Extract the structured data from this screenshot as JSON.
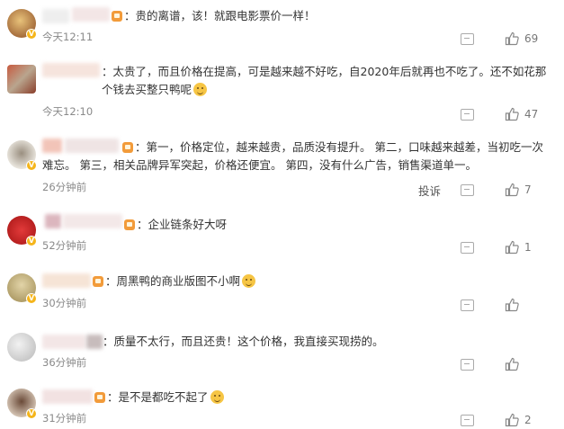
{
  "comments": [
    {
      "text": "：贵的离谱，该！就跟电影票价一样！",
      "time": "今天12:11",
      "likes": "69",
      "report": "",
      "avatar_color": "#c9863b",
      "name_colors": [
        "#e9e9e9",
        "#f2d9d9"
      ],
      "has_vip": true,
      "emoji": false
    },
    {
      "text": "：太贵了，而且价格在提高，可是越来越不好吃，自2020年后就再也不吃了。还不如花那个钱去买整只鸭呢",
      "time": "今天12:10",
      "likes": "47",
      "report": "",
      "avatar_color": "#b8a690",
      "name_colors": [
        "#f4e0d8",
        "#f0e8e0"
      ],
      "has_vip": false,
      "emoji": true
    },
    {
      "text": "：第一，价格定位，越来越贵，品质没有提升。 第二，口味越来越差，当初吃一次难忘。 第三，相关品牌异军突起，价格还便宜。 第四，没有什么广告，销售渠道单一。",
      "time": "26分钟前",
      "likes": "7",
      "report": "投诉",
      "avatar_color": "#c8c0b2",
      "name_colors": [
        "#f2c9c0",
        "#e9d8d8"
      ],
      "has_vip": true,
      "emoji": false
    },
    {
      "text": "：企业链条好大呀",
      "time": "52分钟前",
      "likes": "1",
      "report": "",
      "avatar_color": "#c62a2a",
      "name_colors": [
        "#e5c3c8",
        "#f0e4e4"
      ],
      "has_vip": true,
      "emoji": false
    },
    {
      "text": "：周黑鸭的商业版图不小啊",
      "time": "30分钟前",
      "likes": "",
      "report": "",
      "avatar_color": "#c4b07a",
      "name_colors": [
        "#f5e6d8",
        "#f4d9c8"
      ],
      "has_vip": true,
      "emoji": true
    },
    {
      "text": "：质量不太行，而且还贵！这个价格，我直接买现捞的。",
      "time": "36分钟前",
      "likes": "",
      "report": "",
      "avatar_color": "#d6d6d6",
      "name_colors": [
        "#f0e4e4",
        "#cfc4c4"
      ],
      "has_vip": false,
      "emoji": false
    },
    {
      "text": "：是不是都吃不起了",
      "time": "31分钟前",
      "likes": "2",
      "report": "",
      "avatar_color": "#a88c78",
      "name_colors": [
        "#eddcdc",
        "#f3e4d4"
      ],
      "has_vip": true,
      "emoji": true
    }
  ]
}
